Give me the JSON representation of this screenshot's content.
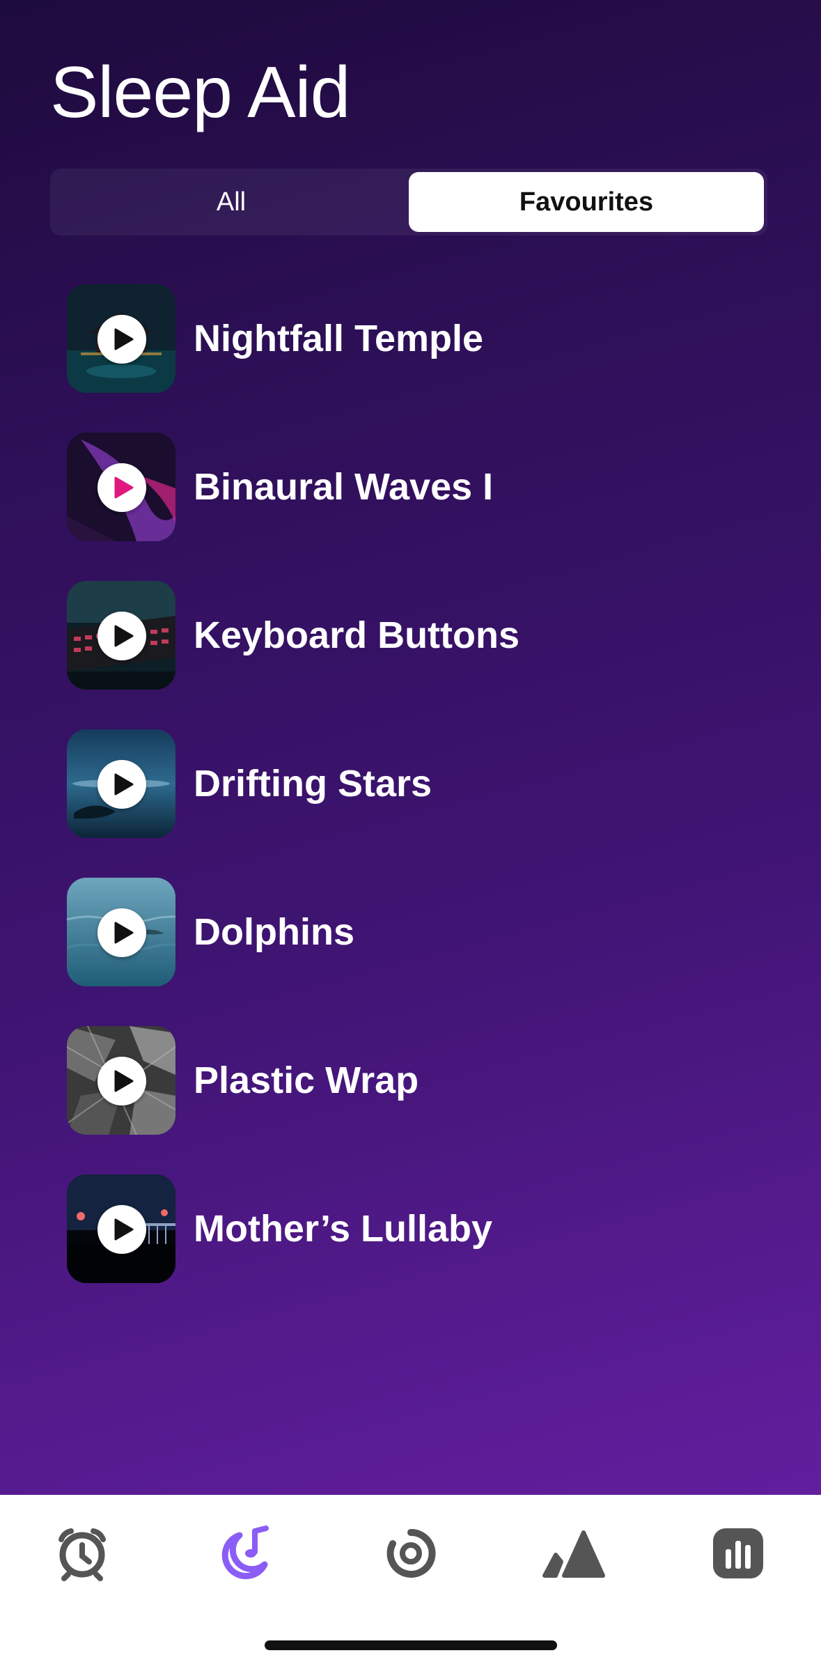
{
  "header": {
    "title": "Sleep Aid"
  },
  "segments": {
    "all_label": "All",
    "favourites_label": "Favourites",
    "selected": "Favourites"
  },
  "sounds": [
    {
      "title": "Nightfall Temple",
      "art": "temple-night",
      "play_color": "#111111"
    },
    {
      "title": "Binaural Waves I",
      "art": "purple-waves",
      "play_color": "#e0177f"
    },
    {
      "title": "Keyboard Buttons",
      "art": "keyboard",
      "play_color": "#111111"
    },
    {
      "title": "Drifting Stars",
      "art": "night-sea",
      "play_color": "#111111"
    },
    {
      "title": "Dolphins",
      "art": "ocean",
      "play_color": "#111111"
    },
    {
      "title": "Plastic Wrap",
      "art": "plastic-wrap",
      "play_color": "#111111"
    },
    {
      "title": "Mother’s Lullaby",
      "art": "night-bridge",
      "play_color": "#111111"
    }
  ],
  "tabbar": {
    "items": [
      {
        "icon": "alarm-clock-icon",
        "active": false
      },
      {
        "icon": "moon-music-icon",
        "active": true
      },
      {
        "icon": "progress-ring-icon",
        "active": false
      },
      {
        "icon": "mountains-icon",
        "active": false
      },
      {
        "icon": "stats-icon",
        "active": false
      }
    ],
    "active_color": "#8b5cf6",
    "inactive_color": "#555555"
  }
}
